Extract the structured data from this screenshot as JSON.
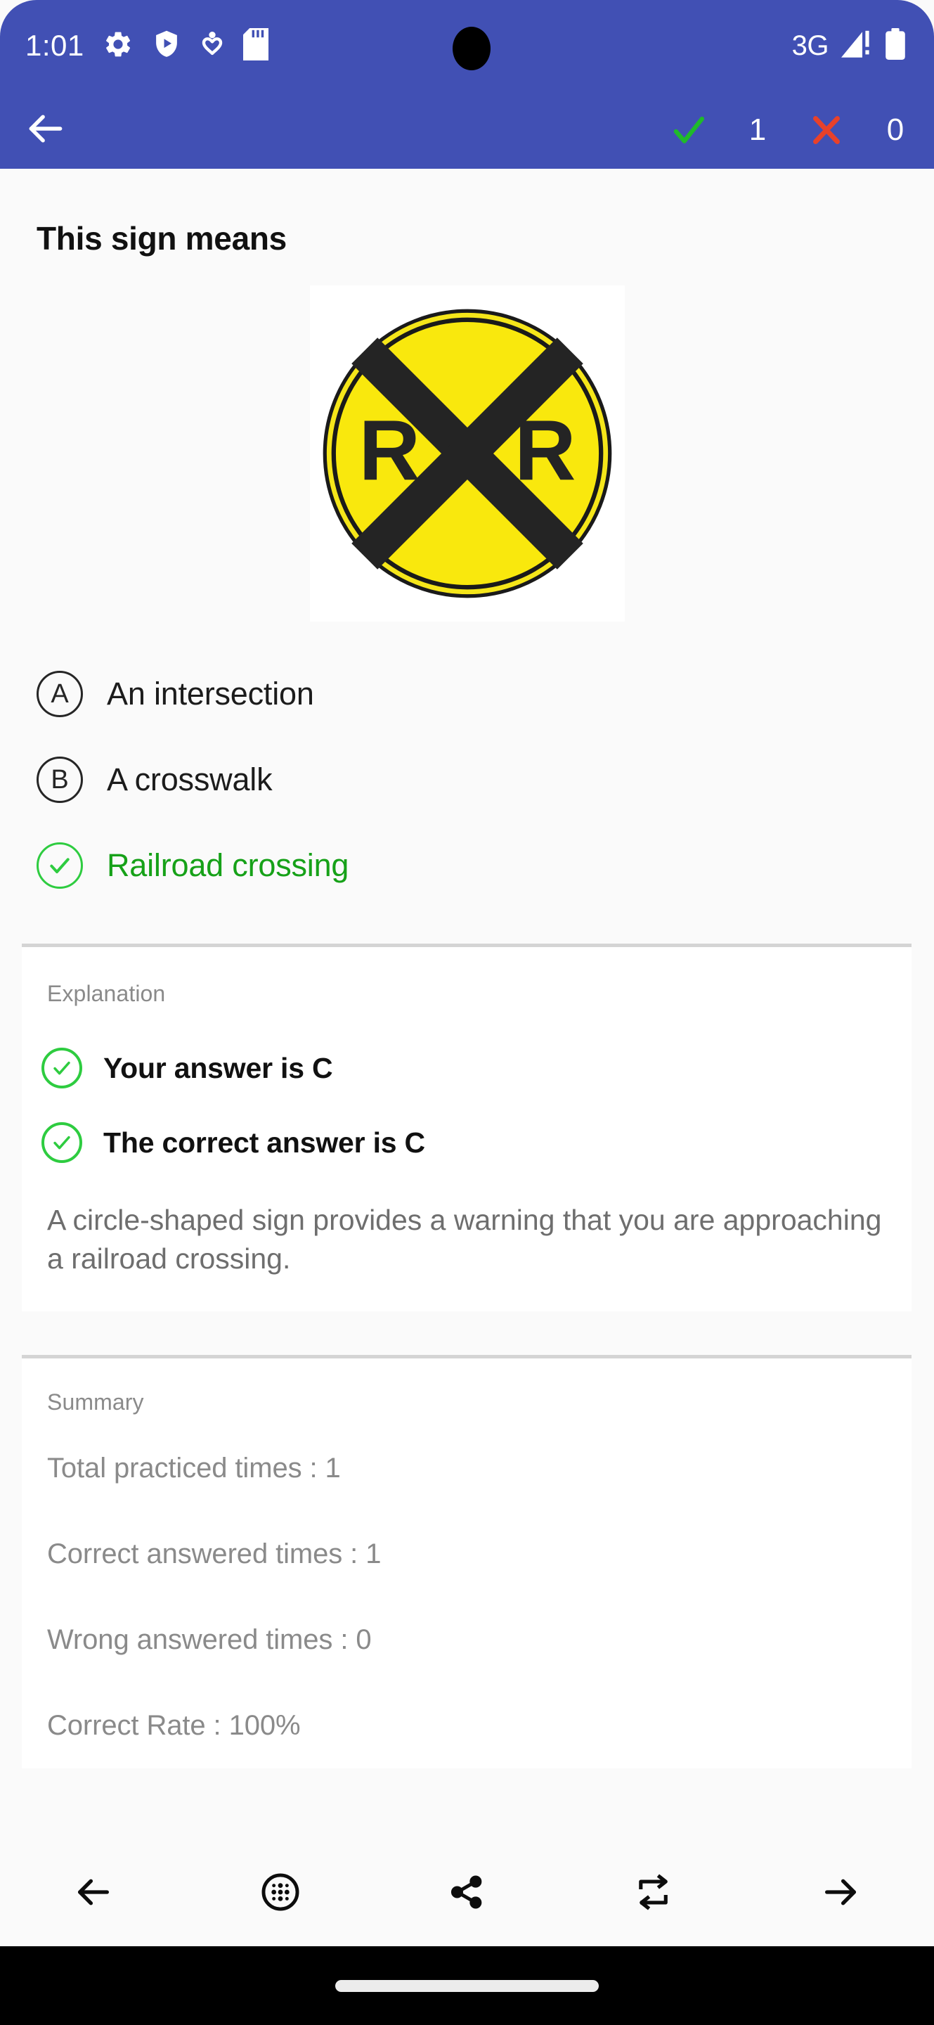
{
  "status_bar": {
    "time": "1:01",
    "network_label": "3G",
    "left_icons": [
      "settings-gear-icon",
      "play-protect-shield-icon",
      "location-heart-icon",
      "sd-card-icon"
    ],
    "right_icons": [
      "signal-bars-warning-icon",
      "battery-icon"
    ],
    "background_color": "#4150b4"
  },
  "app_bar": {
    "back_icon": "arrow-left-icon",
    "correct_mark": "check-icon",
    "correct_count": "1",
    "wrong_mark": "cross-icon",
    "wrong_count": "0",
    "correct_color": "#1fba2a",
    "wrong_color": "#e8412a",
    "background_color": "#4150b4"
  },
  "question": {
    "title": "This sign means",
    "image_alt": "railroad-crossing-sign"
  },
  "options": [
    {
      "badge": "A",
      "label": "An intersection",
      "state": "normal"
    },
    {
      "badge": "B",
      "label": "A crosswalk",
      "state": "normal"
    },
    {
      "badge": "check-icon",
      "label": "Railroad crossing",
      "state": "correct"
    }
  ],
  "explanation": {
    "label": "Explanation",
    "your_answer": "Your answer is C",
    "correct_answer": "The correct answer is C",
    "body": "A circle-shaped sign provides a warning that you are approaching a railroad crossing."
  },
  "summary": {
    "label": "Summary",
    "lines": [
      "Total practiced times : 1",
      "Correct answered times : 1",
      "Wrong answered times : 0",
      "Correct Rate : 100%"
    ]
  },
  "toolbar": {
    "items": [
      {
        "icon": "arrow-left-icon",
        "name": "previous-question-button"
      },
      {
        "icon": "grid-dots-circle-icon",
        "name": "question-list-button"
      },
      {
        "icon": "share-icon",
        "name": "share-button"
      },
      {
        "icon": "repeat-icon",
        "name": "repeat-button"
      },
      {
        "icon": "arrow-right-icon",
        "name": "next-question-button"
      }
    ]
  }
}
